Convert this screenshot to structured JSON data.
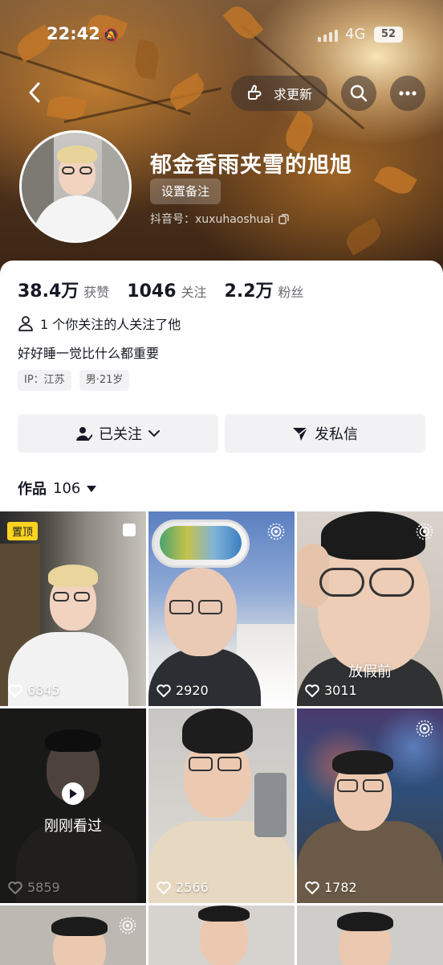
{
  "status_bar": {
    "time": "22:42",
    "network": "4G",
    "battery": "52"
  },
  "header": {
    "request_update_label": "求更新"
  },
  "profile": {
    "name": "郁金香雨夹雪的旭旭",
    "remark_button": "设置备注",
    "douyin_id": "抖音号：xuxuhaoshuai"
  },
  "stats": [
    {
      "value": "38.4万",
      "label": "获赞"
    },
    {
      "value": "1046",
      "label": "关注"
    },
    {
      "value": "2.2万",
      "label": "粉丝"
    }
  ],
  "mutual_follow": "1 个你关注的人关注了他",
  "bio": "好好睡一觉比什么都重要",
  "tags": [
    "IP：江苏",
    "男·21岁"
  ],
  "actions": {
    "followed_label": "已关注",
    "message_label": "发私信"
  },
  "works": {
    "title": "作品",
    "count": "106"
  },
  "videos": [
    {
      "likes": "6845",
      "pinned_label": "置顶"
    },
    {
      "likes": "2920"
    },
    {
      "likes": "3011",
      "caption": "放假前"
    },
    {
      "likes": "5859",
      "recent_label": "刚刚看过"
    },
    {
      "likes": "2566"
    },
    {
      "likes": "1782"
    }
  ],
  "colors": {
    "pin_badge": "#fdd41f",
    "text_primary": "#161823",
    "button_bg": "#f2f2f4"
  }
}
